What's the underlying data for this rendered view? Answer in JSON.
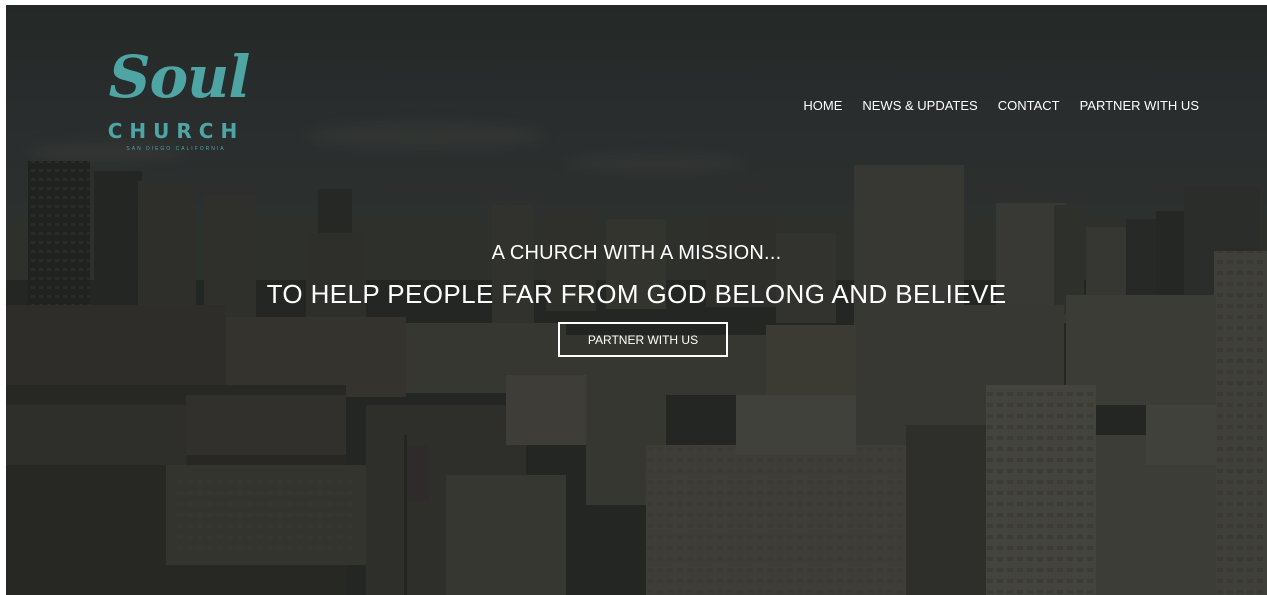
{
  "logo": {
    "script_text": "Soul",
    "word_text": "CHURCH",
    "sub_text": "SAN DIEGO CALIFORNIA",
    "color": "#4fa5a4"
  },
  "nav": {
    "items": [
      {
        "label": "HOME"
      },
      {
        "label": "NEWS & UPDATES"
      },
      {
        "label": "CONTACT"
      },
      {
        "label": "PARTNER WITH US"
      }
    ]
  },
  "hero": {
    "kicker": "A CHURCH WITH A MISSION...",
    "title": "TO HELP PEOPLE FAR FROM GOD BELONG AND BELIEVE",
    "button_label": "PARTNER WITH US"
  }
}
